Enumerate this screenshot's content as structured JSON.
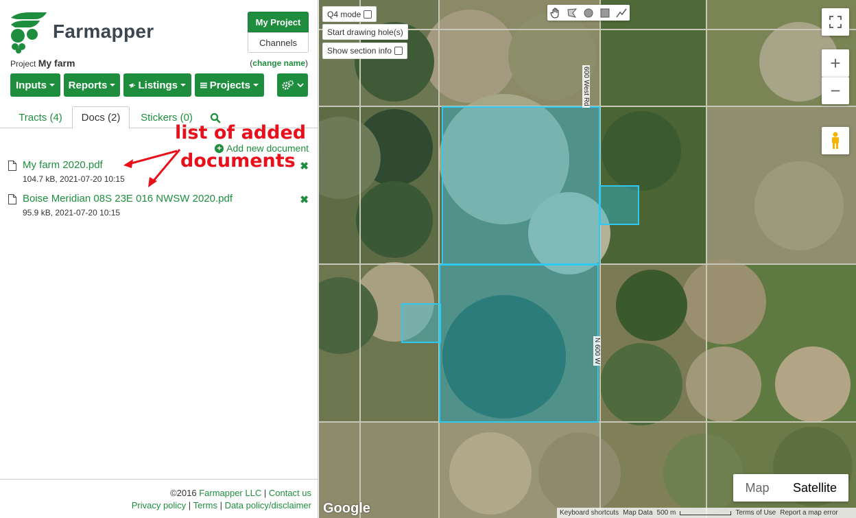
{
  "brand": {
    "name": "Farmapper"
  },
  "header": {
    "my_project": "My Project",
    "channels": "Channels"
  },
  "project": {
    "prefix": "Project",
    "name": "My farm",
    "change_name_open": "(",
    "change_name_link": "change name",
    "change_name_close": ")"
  },
  "menu": {
    "inputs": "Inputs",
    "reports": "Reports",
    "listings": "Listings",
    "projects": "Projects"
  },
  "tabs": {
    "tracts": "Tracts (4)",
    "docs": "Docs (2)",
    "stickers": "Stickers (0)"
  },
  "docs": {
    "add_new": "Add new document",
    "items": [
      {
        "name": "My farm 2020.pdf",
        "meta": "104.7 kB, 2021-07-20 10:15"
      },
      {
        "name": "Boise Meridian 08S 23E 016 NWSW 2020.pdf",
        "meta": "95.9 kB, 2021-07-20 10:15"
      }
    ]
  },
  "annotation": {
    "line1": "list of added",
    "line2": "documents"
  },
  "footer": {
    "copyright": "©2016 ",
    "company": "Farmapper LLC",
    "contact": "Contact us",
    "privacy": "Privacy policy",
    "terms": "Terms",
    "data_policy": "Data policy/disclaimer",
    "sep": " | "
  },
  "map": {
    "q4_mode": "Q4 mode",
    "start_drawing_holes": "Start drawing hole(s)",
    "show_section_info": "Show section info",
    "zoom_in": "+",
    "zoom_out": "−",
    "type_map": "Map",
    "type_satellite": "Satellite",
    "selected_type": "Satellite",
    "google": "Google",
    "attribution": {
      "shortcuts": "Keyboard shortcuts",
      "map_data": "Map Data",
      "scale": "500 m",
      "terms": "Terms of Use",
      "report": "Report a map error"
    },
    "roads": {
      "west_rd": "600 West Rd",
      "n600w": "N 600 W"
    }
  },
  "colors": {
    "accent": "#1e8e3e",
    "annotation": "#e8101a",
    "parcel_stroke": "#2ec8f0"
  }
}
